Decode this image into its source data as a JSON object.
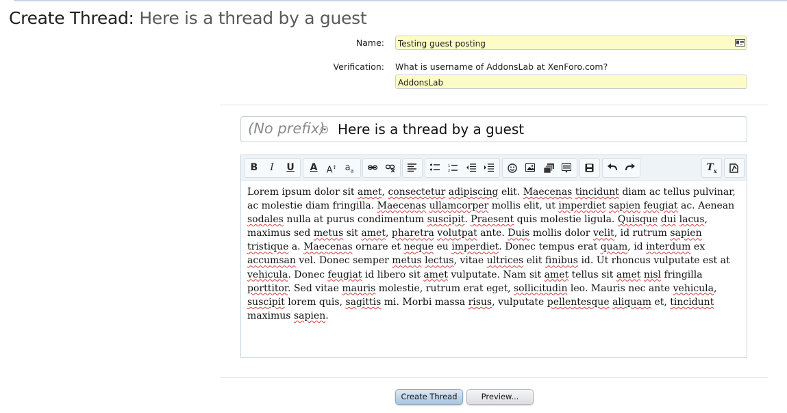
{
  "page": {
    "title_prefix": "Create Thread:",
    "title_thread": "Here is a thread by a guest"
  },
  "form": {
    "name_label": "Name:",
    "name_value": "Testing guest posting",
    "verification_label": "Verification:",
    "verification_question": "What is username of AddonsLab at XenForo.com?",
    "verification_value": "AddonsLab"
  },
  "thread": {
    "prefix": "(No prefix)",
    "title": "Here is a thread by a guest"
  },
  "toolbar": {
    "groups": [
      [
        "bold-icon",
        "italic-icon",
        "underline-icon"
      ],
      [
        "text-color-icon",
        "font-size-icon",
        "font-family-icon"
      ],
      [
        "link-icon",
        "unlink-icon"
      ],
      [
        "align-icon"
      ],
      [
        "bulleted-list-icon",
        "numbered-list-icon",
        "outdent-icon",
        "indent-icon"
      ],
      [
        "smilies-icon",
        "image-icon",
        "media-icon",
        "code-icon"
      ],
      [
        "save-draft-icon"
      ],
      [
        "undo-icon",
        "redo-icon"
      ],
      [
        "remove-formatting-icon"
      ],
      [
        "toggle-bbcode-icon"
      ]
    ]
  },
  "editor": {
    "content": "Lorem ipsum dolor sit amet, consectetur adipiscing elit. Maecenas tincidunt diam ac tellus pulvinar, ac molestie diam fringilla. Maecenas ullamcorper mollis elit, ut imperdiet sapien feugiat ac. Aenean sodales nulla at purus condimentum suscipit. Praesent quis molestie ligula. Quisque dui lacus, maximus sed metus sit amet, pharetra volutpat ante. Duis mollis dolor velit, id rutrum sapien tristique a. Maecenas ornare et neque eu imperdiet. Donec tempus erat quam, id interdum ex accumsan vel. Donec semper metus lectus, vitae ultrices elit finibus id. Ut rhoncus vulputate est at vehicula. Donec feugiat id libero sit amet vulputate. Nam sit amet tellus sit amet nisl fringilla porttitor. Sed vitae mauris molestie, rutrum erat eget, sollicitudin leo. Mauris nec ante vehicula, suscipit lorem quis, sagittis mi. Morbi massa risus, vulputate pellentesque aliquam et, tincidunt maximus sapien.",
    "misspelled_words": [
      "amet",
      "consectetur",
      "adipiscing",
      "Maecenas",
      "tincidunt",
      "ullamcorper",
      "imperdiet",
      "sapien",
      "feugiat",
      "sodales",
      "suscipit",
      "Praesent",
      "Quisque",
      "dui",
      "lacus",
      "metus",
      "pharetra",
      "volutpat",
      "Duis",
      "velit",
      "tristique",
      "neque",
      "quam",
      "interdum",
      "accumsan",
      "lectus",
      "ultrices",
      "finibus",
      "vehicula",
      "nisl",
      "porttitor",
      "mauris",
      "sollicitudin",
      "sagittis",
      "risus",
      "pellentesque",
      "aliquam"
    ]
  },
  "buttons": {
    "create": "Create Thread",
    "preview": "Preview..."
  }
}
